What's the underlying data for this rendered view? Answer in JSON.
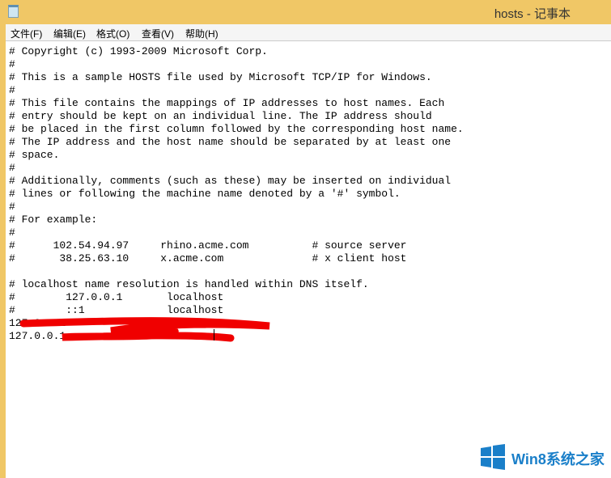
{
  "window": {
    "title": "hosts - 记事本",
    "accent": "#f0c766"
  },
  "menu": [
    "文件(F)",
    "编辑(E)",
    "格式(O)",
    "查看(V)",
    "帮助(H)"
  ],
  "lines": [
    "# Copyright (c) 1993-2009 Microsoft Corp.",
    "#",
    "# This is a sample HOSTS file used by Microsoft TCP/IP for Windows.",
    "#",
    "# This file contains the mappings of IP addresses to host names. Each",
    "# entry should be kept on an individual line. The IP address should",
    "# be placed in the first column followed by the corresponding host name.",
    "# The IP address and the host name should be separated by at least one",
    "# space.",
    "#",
    "# Additionally, comments (such as these) may be inserted on individual",
    "# lines or following the machine name denoted by a '#' symbol.",
    "#",
    "# For example:",
    "#",
    "#      102.54.94.97     rhino.acme.com          # source server",
    "#       38.25.63.10     x.acme.com              # x client host",
    "",
    "# localhost name resolution is handled within DNS itself.",
    "#\t127.0.0.1       localhost",
    "#\t::1             localhost",
    "127.0.0.1",
    "127.0.0.1"
  ],
  "watermark": "Win8系统之家"
}
